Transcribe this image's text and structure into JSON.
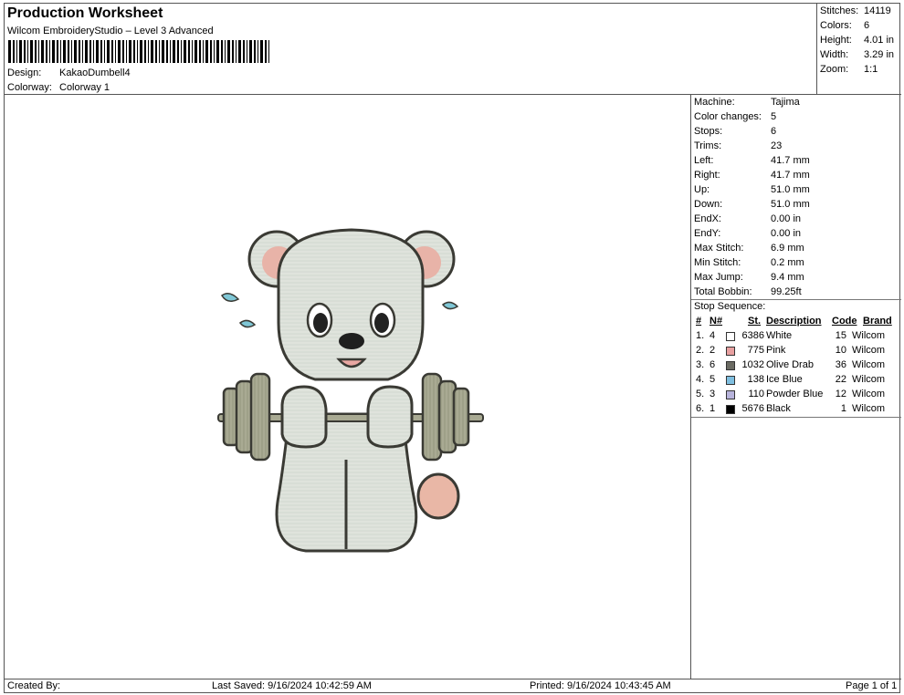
{
  "header": {
    "title": "Production Worksheet",
    "subtitle": "Wilcom EmbroideryStudio – Level 3 Advanced",
    "design_label": "Design:",
    "design_value": "KakaoDumbell4",
    "colorway_label": "Colorway:",
    "colorway_value": "Colorway 1"
  },
  "summary": {
    "stitches_label": "Stitches:",
    "stitches_value": "14119",
    "colors_label": "Colors:",
    "colors_value": "6",
    "height_label": "Height:",
    "height_value": "4.01 in",
    "width_label": "Width:",
    "width_value": "3.29 in",
    "zoom_label": "Zoom:",
    "zoom_value": "1:1"
  },
  "info": [
    {
      "label": "Machine:",
      "value": "Tajima"
    },
    {
      "label": "Color changes:",
      "value": "5"
    },
    {
      "label": "Stops:",
      "value": "6"
    },
    {
      "label": "Trims:",
      "value": "23"
    },
    {
      "label": "Left:",
      "value": "41.7 mm"
    },
    {
      "label": "Right:",
      "value": "41.7 mm"
    },
    {
      "label": "Up:",
      "value": "51.0 mm"
    },
    {
      "label": "Down:",
      "value": "51.0 mm"
    },
    {
      "label": "EndX:",
      "value": "0.00 in"
    },
    {
      "label": "EndY:",
      "value": "0.00 in"
    },
    {
      "label": "Max Stitch:",
      "value": "6.9 mm"
    },
    {
      "label": "Min Stitch:",
      "value": "0.2 mm"
    },
    {
      "label": "Max Jump:",
      "value": "9.4 mm"
    },
    {
      "label": "Total Bobbin:",
      "value": "99.25ft"
    }
  ],
  "stop_sequence": {
    "title": "Stop Sequence:",
    "headers": {
      "num": "#",
      "n": "N#",
      "st": "St.",
      "desc": "Description",
      "code": "Code",
      "brand": "Brand"
    },
    "rows": [
      {
        "num": "1.",
        "n": "4",
        "color": "#ffffff",
        "st": "6386",
        "desc": "White",
        "code": "15",
        "brand": "Wilcom"
      },
      {
        "num": "2.",
        "n": "2",
        "color": "#e8a0a0",
        "st": "775",
        "desc": "Pink",
        "code": "10",
        "brand": "Wilcom"
      },
      {
        "num": "3.",
        "n": "6",
        "color": "#6b6b63",
        "st": "1032",
        "desc": "Olive Drab",
        "code": "36",
        "brand": "Wilcom"
      },
      {
        "num": "4.",
        "n": "5",
        "color": "#7fbfe0",
        "st": "138",
        "desc": "Ice Blue",
        "code": "22",
        "brand": "Wilcom"
      },
      {
        "num": "5.",
        "n": "3",
        "color": "#b8b4dc",
        "st": "110",
        "desc": "Powder Blue",
        "code": "12",
        "brand": "Wilcom"
      },
      {
        "num": "6.",
        "n": "1",
        "color": "#000000",
        "st": "5676",
        "desc": "Black",
        "code": "1",
        "brand": "Wilcom"
      }
    ]
  },
  "footer": {
    "created": "Created By:",
    "last_saved": "Last Saved: 9/16/2024 10:42:59 AM",
    "printed": "Printed: 9/16/2024 10:43:45 AM",
    "page": "Page 1 of 1"
  }
}
